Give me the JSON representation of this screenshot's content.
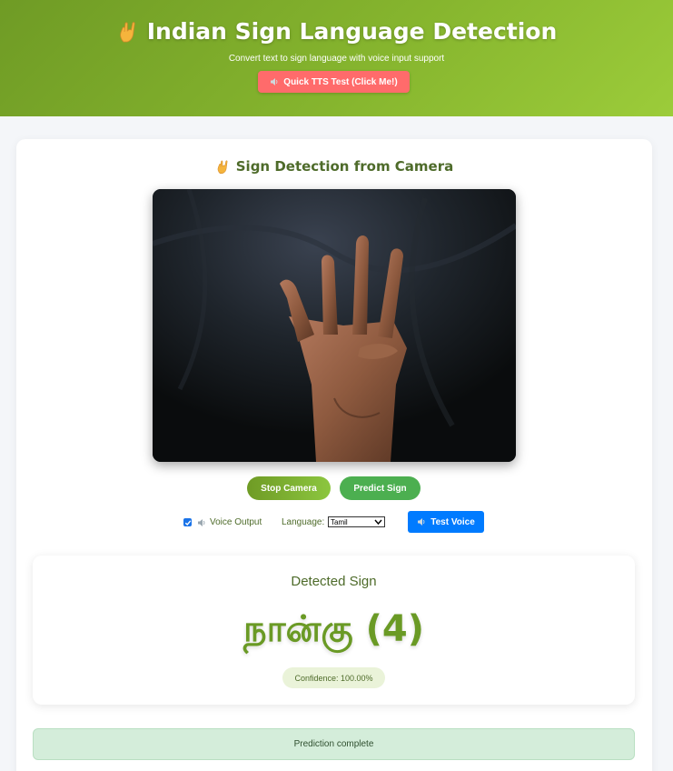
{
  "header": {
    "title": "Indian Sign Language Detection",
    "subtitle": "Convert text to sign language with voice input support",
    "tts_button": "Quick TTS Test (Click Me!)",
    "icon": "sign-hand-icon"
  },
  "camera_section": {
    "title": "Sign Detection from Camera",
    "icon": "sign-hand-icon"
  },
  "buttons": {
    "stop_camera": "Stop Camera",
    "predict_sign": "Predict Sign",
    "test_voice": "Test Voice"
  },
  "voice": {
    "label": "Voice Output",
    "checked": true,
    "icon": "speaker-icon"
  },
  "language": {
    "label": "Language:",
    "selected": "Tamil"
  },
  "result": {
    "label": "Detected Sign",
    "sign": "நான்கு (4)",
    "confidence": "Confidence: 100.00%"
  },
  "status": {
    "message": "Prediction complete"
  },
  "colors": {
    "header_gradient_start": "#6f9b25",
    "header_gradient_end": "#9ccc3a",
    "tts_button": "#ff6b6b",
    "test_voice_button": "#007bff",
    "predict_button": "#4caf50",
    "status_bg": "#d4edda"
  }
}
